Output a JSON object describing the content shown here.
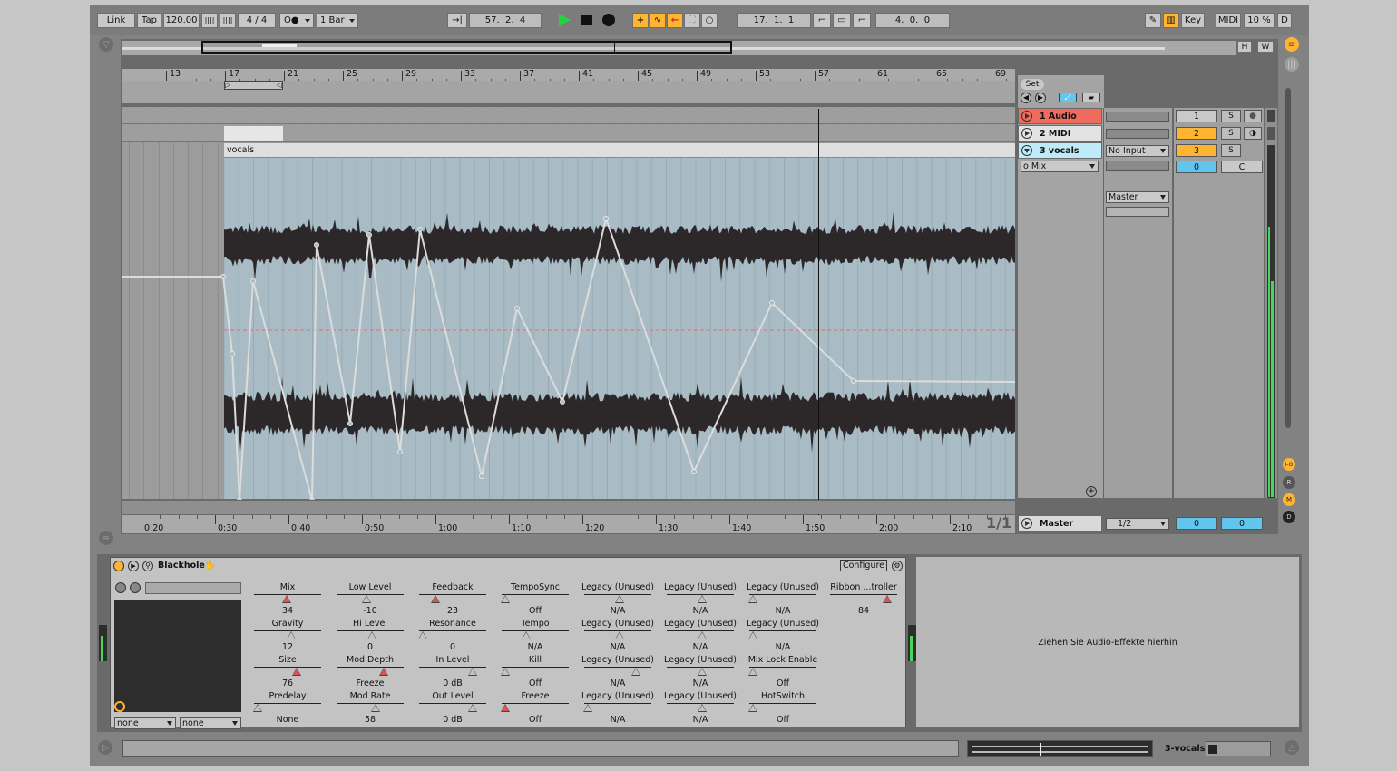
{
  "transport": {
    "link": "Link",
    "tap": "Tap",
    "tempo": "120.00",
    "meter": "4  /  4",
    "quantize": "1 Bar",
    "position": "57.  2.  4",
    "loop_start": "17.  1.  1",
    "loop_length": "4.  0.  0",
    "key": "Key",
    "midi": "MIDI",
    "cpu": "10 %",
    "disk": "D"
  },
  "overview": {
    "h": "H",
    "w": "W"
  },
  "ruler": {
    "bars": [
      "13",
      "17",
      "21",
      "25",
      "29",
      "33",
      "37",
      "41",
      "45",
      "49",
      "53",
      "57",
      "61",
      "65",
      "69"
    ],
    "times": [
      "0:20",
      "0:30",
      "0:40",
      "0:50",
      "1:00",
      "1:10",
      "1:20",
      "1:30",
      "1:40",
      "1:50",
      "2:00",
      "2:10"
    ],
    "page": "1/1"
  },
  "clip": {
    "name": "vocals"
  },
  "session": {
    "set_label": "Set",
    "tracks": [
      {
        "name": "1 Audio",
        "number": "1",
        "solo": "S",
        "color": "#ef6b5e"
      },
      {
        "name": "2 MIDI",
        "number": "2",
        "solo": "S",
        "color": "#e3e3e3"
      },
      {
        "name": "3 vocals",
        "number": "3",
        "solo": "S",
        "color": "#bfeaf7"
      }
    ],
    "input": "No Input",
    "monitor": "o Mix",
    "output": "Master",
    "volume": "0",
    "pan": "C",
    "master": {
      "name": "Master",
      "cue": "1/2",
      "volume": "0",
      "pan": "0"
    },
    "status_dots": [
      "I-O",
      "R",
      "M",
      "D"
    ]
  },
  "device": {
    "name": "Blackhole",
    "configure": "Configure",
    "selects": [
      "none",
      "none"
    ],
    "drop_hint": "Ziehen Sie Audio-Effekte hierhin",
    "params": [
      {
        "label": "Mix",
        "value": "34",
        "pos": 0.46,
        "red": true
      },
      {
        "label": "Gravity",
        "value": "12",
        "pos": 0.53,
        "red": false
      },
      {
        "label": "Size",
        "value": "76",
        "pos": 0.62,
        "red": true
      },
      {
        "label": "Predelay",
        "value": "None",
        "pos": 0.0,
        "red": false
      },
      {
        "label": "Low Level",
        "value": "-10",
        "pos": 0.42,
        "red": false
      },
      {
        "label": "Hi Level",
        "value": "0",
        "pos": 0.5,
        "red": false
      },
      {
        "label": "Mod Depth",
        "value": "Freeze",
        "pos": 0.68,
        "red": true
      },
      {
        "label": "Mod Rate",
        "value": "58",
        "pos": 0.56,
        "red": false
      },
      {
        "label": "Feedback",
        "value": "23",
        "pos": 0.2,
        "red": true
      },
      {
        "label": "Resonance",
        "value": "0",
        "pos": 0.0,
        "red": false
      },
      {
        "label": "In Level",
        "value": "0 dB",
        "pos": 0.78,
        "red": false
      },
      {
        "label": "Out Level",
        "value": "0 dB",
        "pos": 0.78,
        "red": false
      },
      {
        "label": "TempoSync",
        "value": "Off",
        "pos": 0.0,
        "red": false
      },
      {
        "label": "Tempo",
        "value": "N/A",
        "pos": 0.33,
        "red": false
      },
      {
        "label": "Kill",
        "value": "Off",
        "pos": 0.0,
        "red": false
      },
      {
        "label": "Freeze",
        "value": "Off",
        "pos": 0.0,
        "red": true
      },
      {
        "label": "Legacy (Unused)",
        "value": "N/A",
        "pos": 0.5,
        "red": false
      },
      {
        "label": "Legacy (Unused)",
        "value": "N/A",
        "pos": 0.5,
        "red": false
      },
      {
        "label": "Legacy (Unused)",
        "value": "N/A",
        "pos": 0.75,
        "red": false
      },
      {
        "label": "Legacy (Unused)",
        "value": "N/A",
        "pos": 0.0,
        "red": false
      },
      {
        "label": "Legacy (Unused)",
        "value": "N/A",
        "pos": 0.5,
        "red": false
      },
      {
        "label": "Legacy (Unused)",
        "value": "N/A",
        "pos": 0.5,
        "red": false
      },
      {
        "label": "Legacy (Unused)",
        "value": "N/A",
        "pos": 0.5,
        "red": false
      },
      {
        "label": "Legacy (Unused)",
        "value": "N/A",
        "pos": 0.5,
        "red": false
      },
      {
        "label": "Legacy (Unused)",
        "value": "N/A",
        "pos": 0.0,
        "red": false
      },
      {
        "label": "Legacy (Unused)",
        "value": "N/A",
        "pos": 0.0,
        "red": false
      },
      {
        "label": "Mix Lock Enable",
        "value": "Off",
        "pos": 0.0,
        "red": false
      },
      {
        "label": "HotSwitch",
        "value": "Off",
        "pos": 0.0,
        "red": false
      },
      {
        "label": "Ribbon ...troller",
        "value": "84",
        "pos": 0.84,
        "red": true
      }
    ]
  },
  "statusbar": {
    "track": "3-vocals"
  },
  "colors": {
    "accent": "#ffb532",
    "clip_bg": "#a9bcc6",
    "waveform": "#2c2729",
    "automation": "#dcdcdc",
    "selected": "#62c5ee"
  }
}
